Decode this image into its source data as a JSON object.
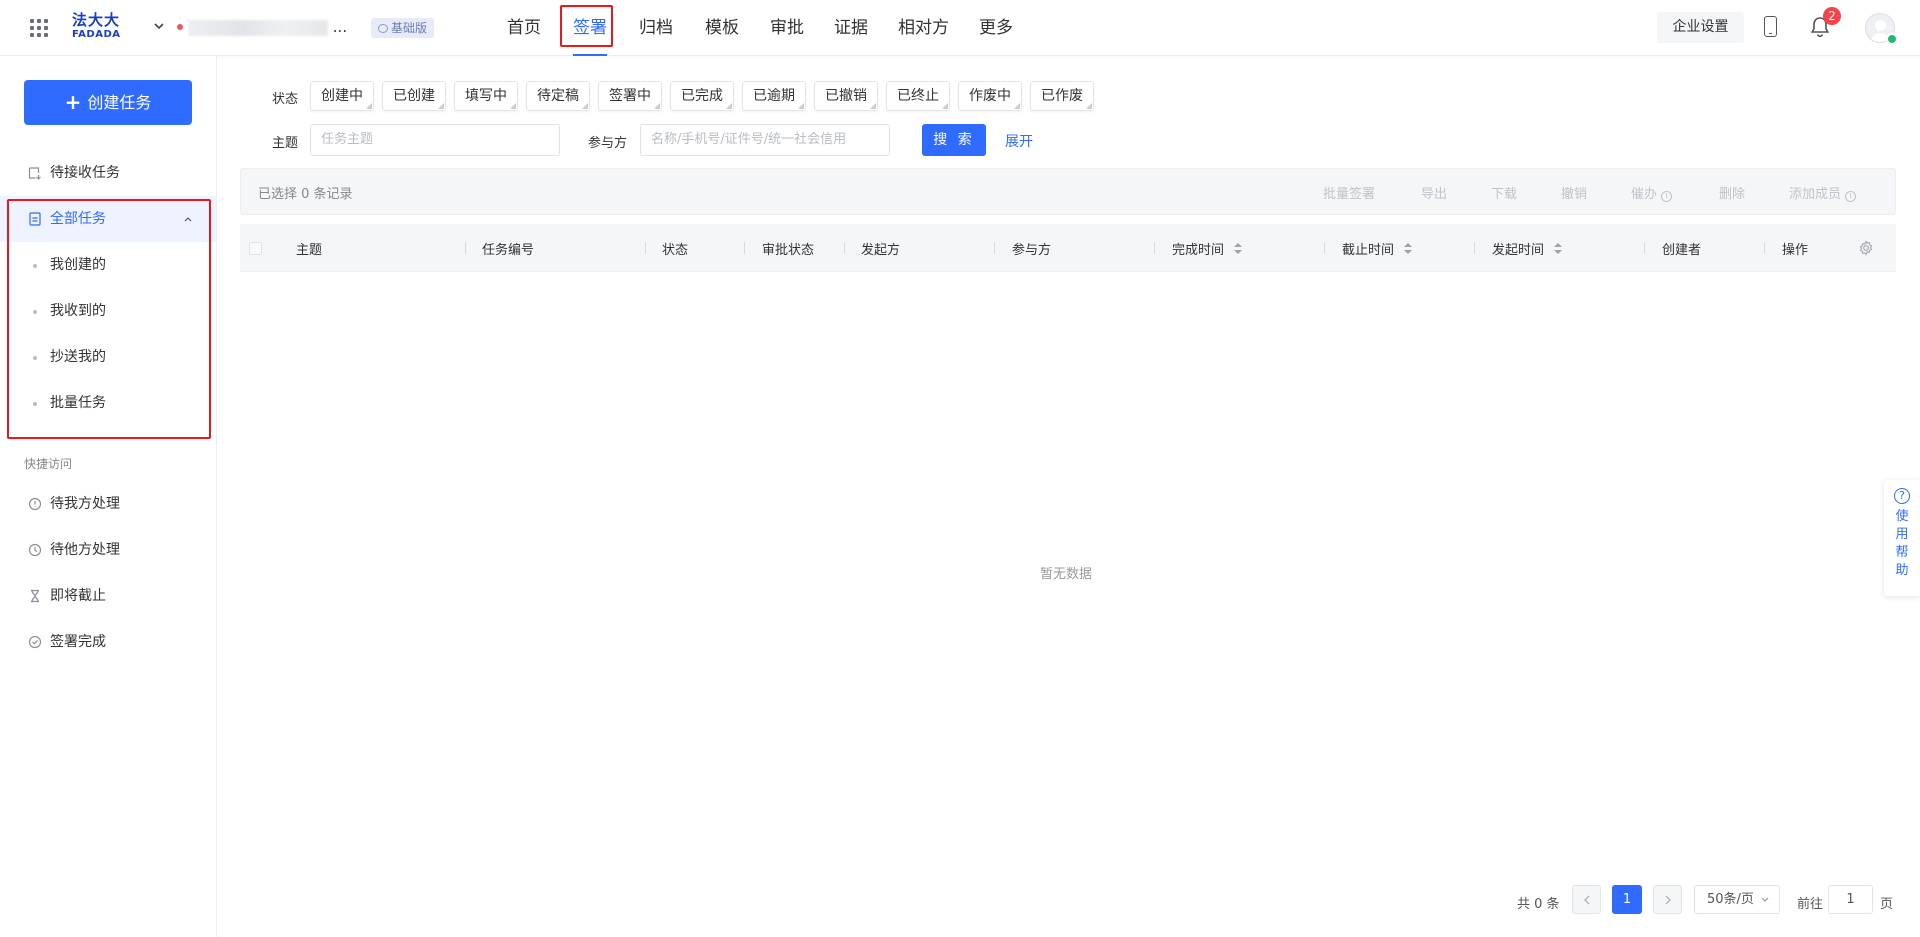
{
  "header": {
    "logo_cn": "法大大",
    "logo_en": "FADADA",
    "org_suffix": "...",
    "plan_badge": "基础版",
    "nav": [
      "首页",
      "签署",
      "归档",
      "模板",
      "审批",
      "证据",
      "相对方",
      "更多"
    ],
    "active_nav": "签署",
    "enterprise_settings": "企业设置",
    "notification_count": "2"
  },
  "sidebar": {
    "create_button": "创建任务",
    "pending_receive": "待接收任务",
    "all_tasks": "全部任务",
    "sub_items": [
      "我创建的",
      "我收到的",
      "抄送我的",
      "批量任务"
    ],
    "quick_access_title": "快捷访问",
    "quick_items": [
      "待我方处理",
      "待他方处理",
      "即将截止",
      "签署完成"
    ]
  },
  "filters": {
    "status_label": "状态",
    "statuses": [
      "创建中",
      "已创建",
      "填写中",
      "待定稿",
      "签署中",
      "已完成",
      "已逾期",
      "已撤销",
      "已终止",
      "作废中",
      "已作废"
    ],
    "subject_label": "主题",
    "subject_placeholder": "任务主题",
    "participant_label": "参与方",
    "participant_placeholder": "名称/手机号/证件号/统一社会信用",
    "search_button": "搜 索",
    "expand_link": "展开"
  },
  "toolbar": {
    "selected_text": "已选择 0 条记录",
    "actions": [
      "批量签署",
      "导出",
      "下载",
      "撤销",
      "催办",
      "删除",
      "添加成员"
    ]
  },
  "table": {
    "columns": [
      "主题",
      "任务编号",
      "状态",
      "审批状态",
      "发起方",
      "参与方",
      "完成时间",
      "截止时间",
      "发起时间",
      "创建者",
      "操作"
    ],
    "empty_text": "暂无数据"
  },
  "pagination": {
    "total_text": "共 0 条",
    "current_page": "1",
    "page_size": "50条/页",
    "goto_label": "前往",
    "goto_value": "1",
    "page_suffix": "页"
  },
  "help": {
    "label": "使用帮助",
    "chars": [
      "使",
      "用",
      "帮",
      "助"
    ]
  }
}
